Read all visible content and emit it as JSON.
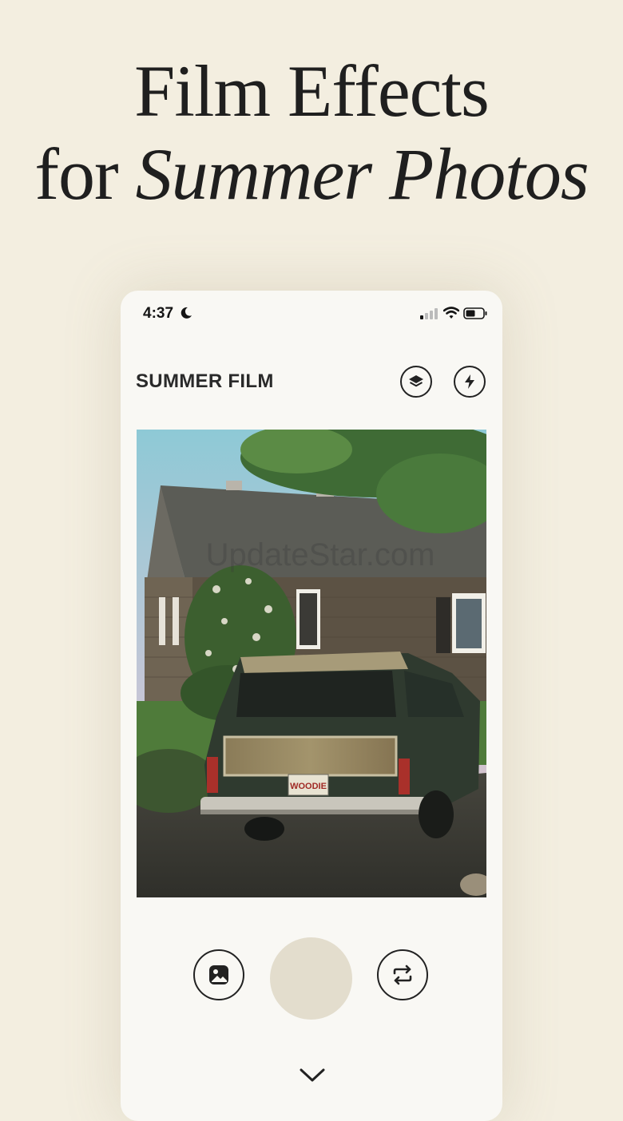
{
  "headline": {
    "line1": "Film Effects",
    "line2_prefix": "for",
    "line2_italic": "Summer Photos"
  },
  "status_bar": {
    "time": "4:37",
    "icons": [
      "moon-icon",
      "cellular-signal-icon",
      "wifi-icon",
      "battery-icon"
    ]
  },
  "app_bar": {
    "title": "SUMMER FILM",
    "actions": [
      "layers-icon",
      "flash-icon"
    ]
  },
  "photo": {
    "watermark": "UpdateStar.com",
    "plate_text": "WOODIE"
  },
  "controls": {
    "left": "gallery-icon",
    "center": "shutter-button",
    "right": "switch-camera-icon",
    "bottom": "chevron-down-icon"
  },
  "colors": {
    "background": "#f3eee0",
    "panel": "#f9f8f4",
    "shutter": "#e3ddcd",
    "ink": "#222222"
  }
}
